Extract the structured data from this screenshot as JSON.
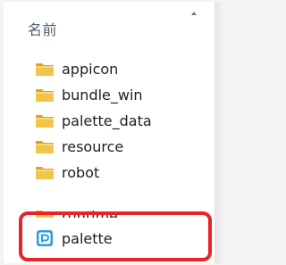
{
  "list": {
    "column_header": "名前",
    "items": [
      {
        "label": "appicon",
        "icon": "folder-icon"
      },
      {
        "label": "bundle_win",
        "icon": "folder-icon"
      },
      {
        "label": "palette_data",
        "icon": "folder-icon"
      },
      {
        "label": "resource",
        "icon": "folder-icon"
      },
      {
        "label": "robot",
        "icon": "folder-icon"
      },
      {
        "label": "runtime",
        "icon": "folder-icon"
      },
      {
        "label": "palette",
        "icon": "app-icon"
      }
    ]
  },
  "highlight_color": "#e8232a"
}
